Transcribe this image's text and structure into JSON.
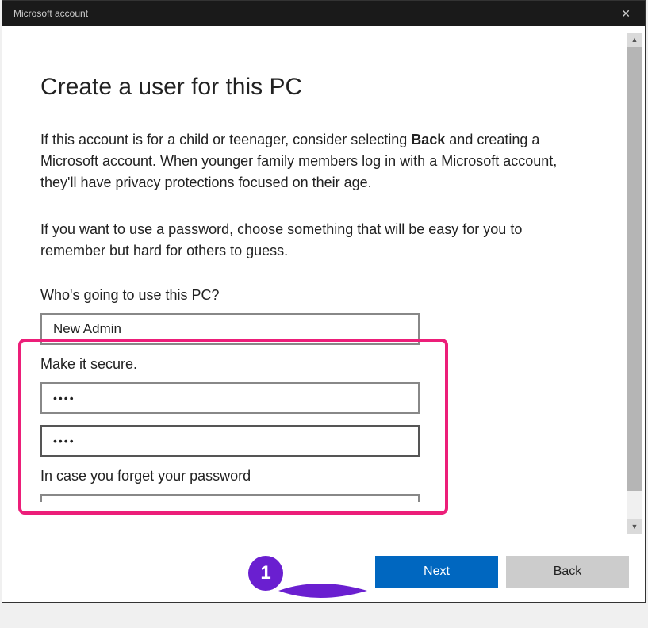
{
  "window": {
    "title": "Microsoft account"
  },
  "heading": "Create a user for this PC",
  "paragraph1_pre": "If this account is for a child or teenager, consider selecting ",
  "paragraph1_bold": "Back",
  "paragraph1_post": " and creating a Microsoft account. When younger family members log in with a Microsoft account, they'll have privacy protections focused on their age.",
  "paragraph2": "If you want to use a password, choose something that will be easy for you to remember but hard for others to guess.",
  "section_user_label": "Who's going to use this PC?",
  "username_value": "New Admin",
  "section_password_label": "Make it secure.",
  "password_value": "••••",
  "password_confirm_value": "••••",
  "section_hint_label": "In case you forget your password",
  "buttons": {
    "next": "Next",
    "back": "Back"
  },
  "annotation": {
    "number": "1"
  }
}
